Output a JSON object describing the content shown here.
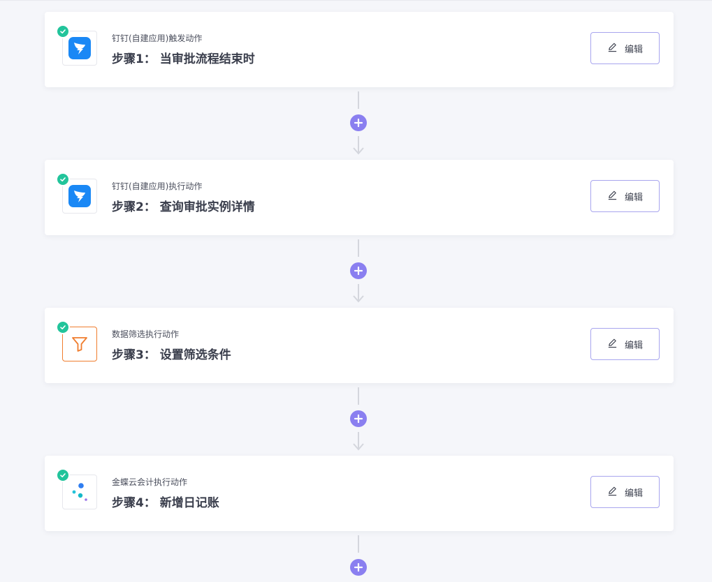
{
  "steps": [
    {
      "subtitle": "钉钉(自建应用)触发动作",
      "title": "步骤1： 当审批流程结束时",
      "icon": "dingtalk-icon",
      "edit_label": "编辑"
    },
    {
      "subtitle": "钉钉(自建应用)执行动作",
      "title": "步骤2： 查询审批实例详情",
      "icon": "dingtalk-icon",
      "edit_label": "编辑"
    },
    {
      "subtitle": "数据筛选执行动作",
      "title": "步骤3： 设置筛选条件",
      "icon": "filter-icon",
      "edit_label": "编辑"
    },
    {
      "subtitle": "金蝶云会计执行动作",
      "title": "步骤4： 新增日记账",
      "icon": "kingdee-icon",
      "edit_label": "编辑"
    }
  ],
  "colors": {
    "accent": "#8a7ff0",
    "check": "#22c49b",
    "dingtalk": "#1a88f5",
    "filter": "#f07d2e",
    "connector_line": "#d4d6dd"
  }
}
